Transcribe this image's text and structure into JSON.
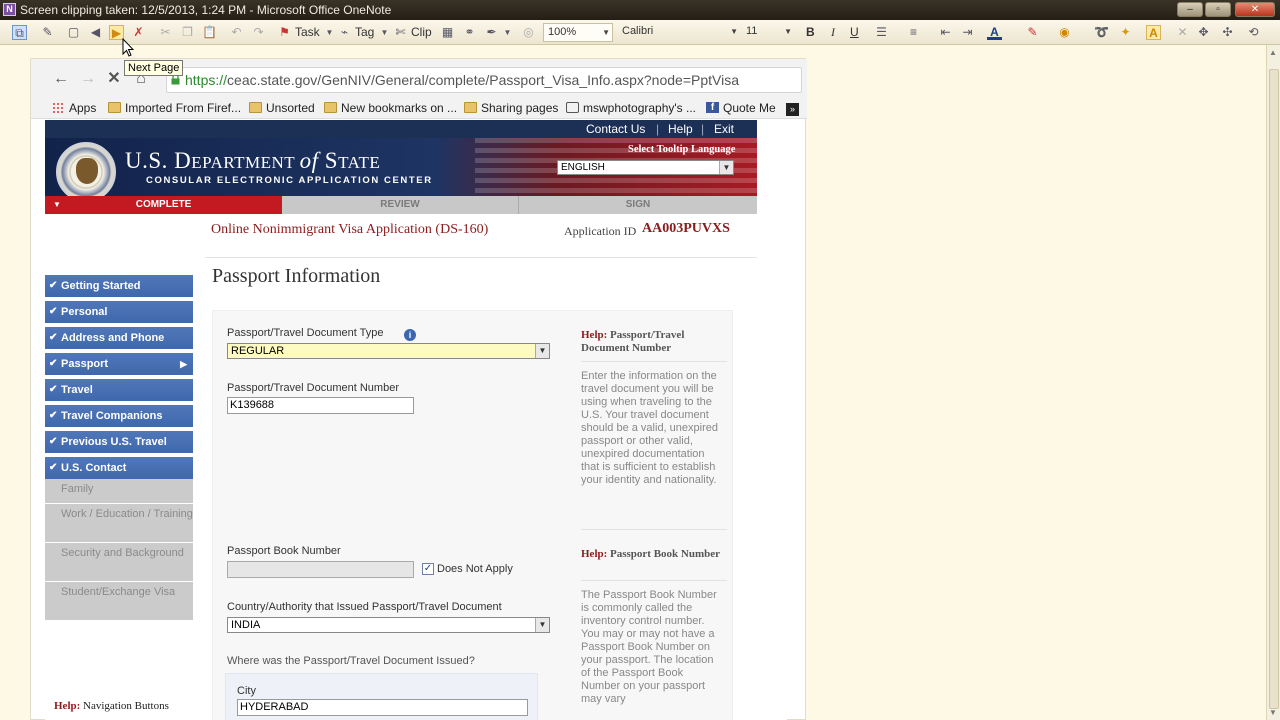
{
  "window": {
    "title": "Screen clipping taken: 12/5/2013, 1:24 PM - Microsoft Office OneNote",
    "controls": [
      "–",
      "▫",
      "✕"
    ]
  },
  "toolbar": {
    "task_label": "Task",
    "tag_label": "Tag",
    "clip_label": "Clip",
    "zoom_value": "100%",
    "font_value": "Calibri",
    "size_value": "11",
    "bold": "B",
    "italic": "I",
    "underline": "U"
  },
  "tooltip": {
    "text": "Next Page"
  },
  "browser": {
    "url_scheme": "https://",
    "url_host_path": "ceac.state.gov/GenNIV/General/complete/Passport_Visa_Info.aspx?node=PptVisa",
    "bookmarks": [
      {
        "label": "Apps",
        "icon": "apps-grid-icon"
      },
      {
        "label": "Imported From Firef...",
        "icon": "folder-icon"
      },
      {
        "label": "Unsorted",
        "icon": "folder-icon"
      },
      {
        "label": "New bookmarks on ...",
        "icon": "folder-icon"
      },
      {
        "label": "Sharing pages",
        "icon": "folder-icon"
      },
      {
        "label": "mswphotography's ...",
        "icon": "camera-icon"
      },
      {
        "label": "Quote Me",
        "icon": "facebook-icon"
      }
    ]
  },
  "site": {
    "topnav": {
      "contact": "Contact Us",
      "help": "Help",
      "exit": "Exit",
      "sep": "|"
    },
    "dept_title_1": "U.S. D",
    "dept_title_2": "EPARTMENT ",
    "dept_title_of": "of",
    "dept_title_3": " S",
    "dept_title_4": "TATE",
    "dept_sub": "CONSULAR ELECTRONIC APPLICATION CENTER",
    "tooltip_lang_label": "Select Tooltip Language",
    "tooltip_lang_value": "ENGLISH",
    "steps": [
      "COMPLETE",
      "REVIEW",
      "SIGN"
    ],
    "app_title": "Online Nonimmigrant Visa Application (DS-160)",
    "app_id_label": "Application ID",
    "app_id": "AA003PUVXS",
    "page_title": "Passport Information"
  },
  "sidebar": {
    "items": [
      {
        "label": "Getting Started"
      },
      {
        "label": "Personal"
      },
      {
        "label": "Address and Phone"
      },
      {
        "label": "Passport"
      },
      {
        "label": "Travel"
      },
      {
        "label": "Travel Companions"
      },
      {
        "label": "Previous U.S. Travel"
      },
      {
        "label": "U.S. Contact"
      },
      {
        "label": "Family"
      },
      {
        "label": "Work / Education / Training"
      },
      {
        "label": "Security and Background"
      },
      {
        "label": "Student/Exchange Visa"
      }
    ],
    "help_prefix": "Help:",
    "help_text": "Navigation Buttons"
  },
  "form": {
    "doc_type_label": "Passport/Travel Document Type",
    "doc_type_value": "REGULAR",
    "doc_number_label": "Passport/Travel Document Number",
    "doc_number_value": "K139688",
    "book_number_label": "Passport Book Number",
    "book_number_value": "",
    "does_not_apply_label": "Does Not Apply",
    "does_not_apply_checked": "✓",
    "country_label": "Country/Authority that Issued Passport/Travel Document",
    "country_value": "INDIA",
    "issued_where_label": "Where was the Passport/Travel Document Issued?",
    "city_label": "City",
    "city_value": "HYDERABAD"
  },
  "help": {
    "prefix": "Help:",
    "doc_number_title": "Passport/Travel Document Number",
    "doc_number_text": "Enter the information on the travel document you will be using when traveling to the U.S. Your travel document should be a valid, unexpired passport or other valid, unexpired documentation that is sufficient to establish your identity and nationality.",
    "book_number_title": "Passport Book Number",
    "book_number_text": "The Passport Book Number is commonly called the inventory control number. You may or may not have a Passport Book Number on your passport. The location of the Passport Book Number on your passport may vary"
  },
  "colors": {
    "nav_blue": "#3f68ad",
    "seal_navy": "#1c2f55",
    "active_red": "#c31a22",
    "heading_red": "#8a1c1c",
    "onenote_bg": "#fdf9e4"
  }
}
